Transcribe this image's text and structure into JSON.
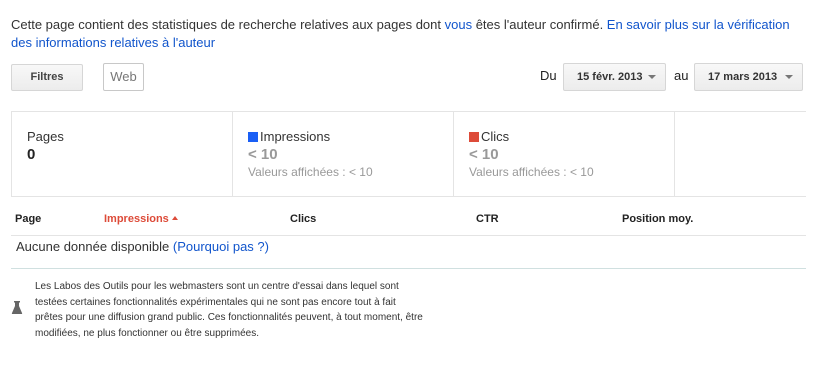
{
  "intro": {
    "text_part1": "Cette page contient des statistiques de recherche relatives aux pages dont ",
    "link_vous": "vous",
    "text_part2": " êtes l'auteur confirmé. ",
    "link_learn_more": "En savoir plus sur la vérification des informations relatives à l'auteur"
  },
  "toolbar": {
    "filters_label": "Filtres",
    "web_value": "Web",
    "date_from_label": "Du",
    "date_from_value": "15 févr. 2013",
    "date_to_label": "au",
    "date_to_value": "17 mars 2013"
  },
  "stats": {
    "pages": {
      "title": "Pages",
      "value": "0"
    },
    "impressions": {
      "title": "Impressions",
      "value": "< 10",
      "sub": "Valeurs affichées : < 10",
      "color": "#1a5ff5"
    },
    "clicks": {
      "title": "Clics",
      "value": "< 10",
      "sub": "Valeurs affichées : < 10",
      "color": "#dd4b39"
    }
  },
  "table": {
    "columns": [
      "Page",
      "Impressions",
      "Clics",
      "CTR",
      "Position moy."
    ],
    "sorted_column": "Impressions",
    "sort_direction": "ascending",
    "empty_text": "Aucune donnée disponible ",
    "empty_link": "(Pourquoi pas ?)"
  },
  "labs": {
    "icon": "flask-icon",
    "text": "Les Labos des Outils pour les webmasters sont un centre d'essai dans lequel sont testées certaines fonctionnalités expérimentales qui ne sont pas encore tout à fait prêtes pour une diffusion grand public. Ces fonctionnalités peuvent, à tout moment, être modifiées, ne plus fonctionner ou être supprimées."
  }
}
